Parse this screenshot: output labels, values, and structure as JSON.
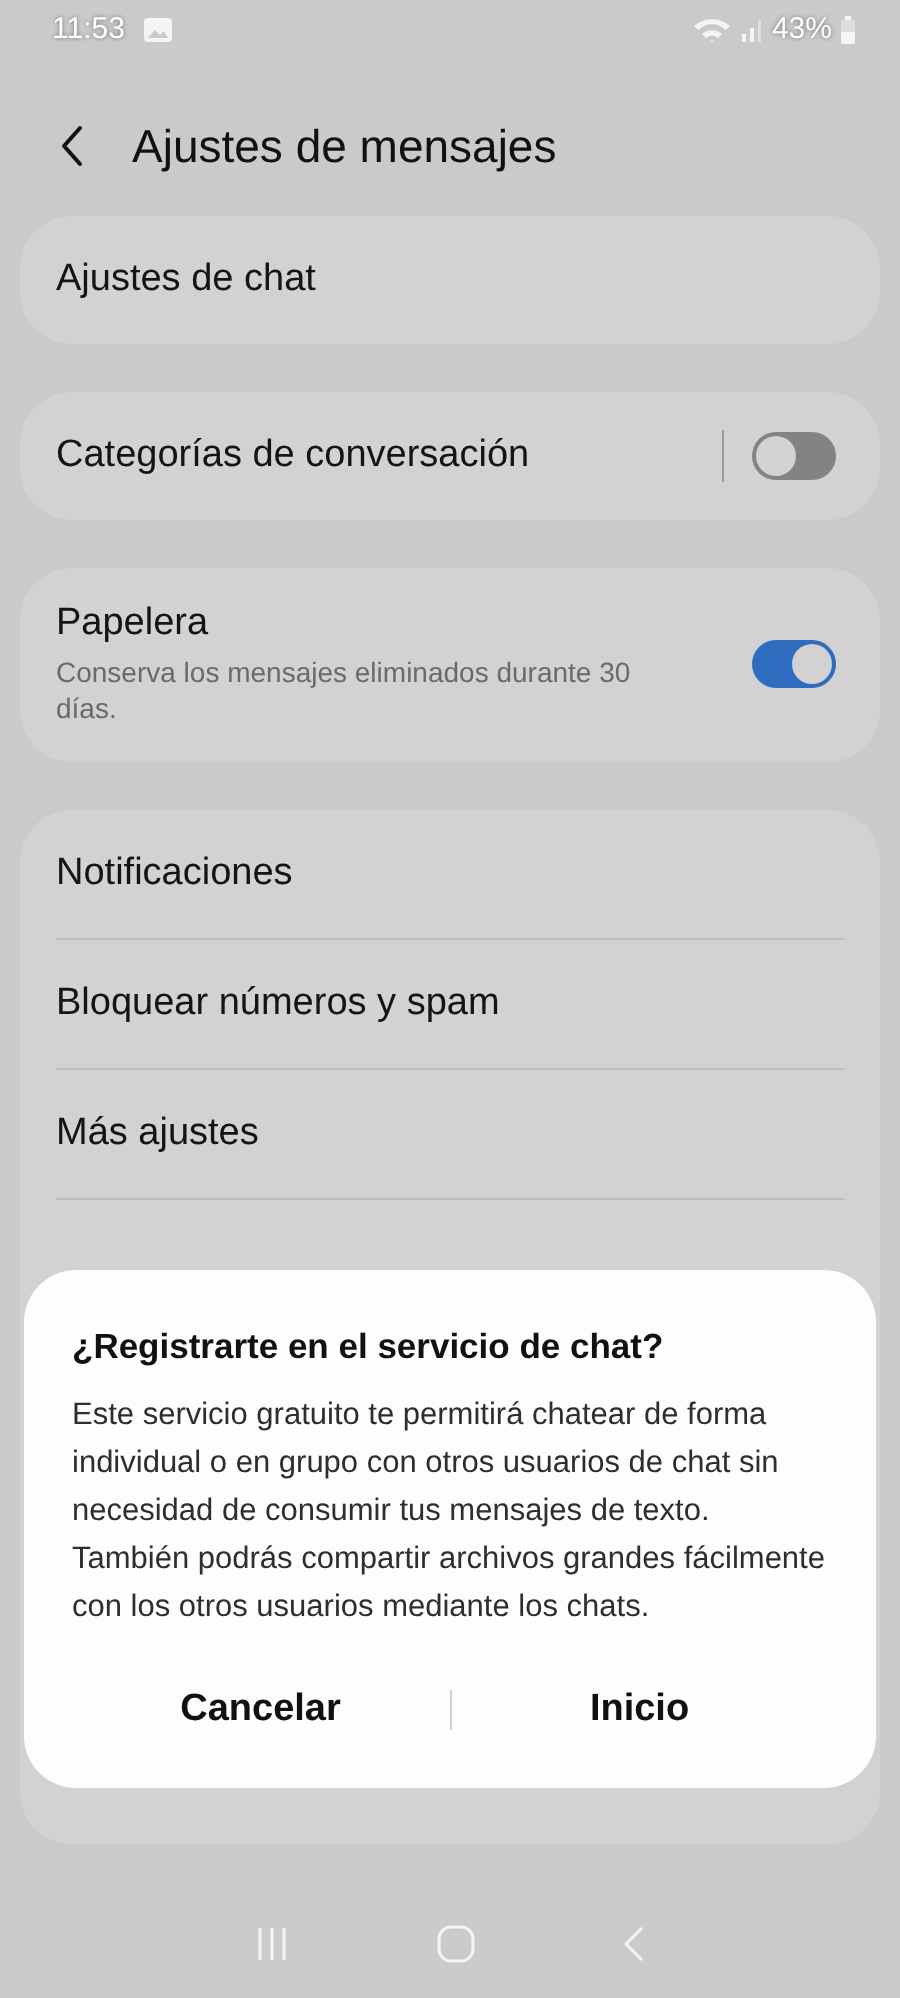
{
  "status_bar": {
    "time": "11:53",
    "battery": "43%"
  },
  "header": {
    "title": "Ajustes de mensajes"
  },
  "sections": [
    {
      "rows": [
        {
          "kind": "link",
          "title": "Ajustes de chat"
        }
      ]
    },
    {
      "rows": [
        {
          "kind": "toggle",
          "title": "Categorías de conversación",
          "on": false
        }
      ]
    },
    {
      "rows": [
        {
          "kind": "toggle",
          "title": "Papelera",
          "subtitle": "Conserva los mensajes eliminados durante 30 días.",
          "on": true
        }
      ]
    },
    {
      "rows": [
        {
          "kind": "link",
          "title": "Notificaciones"
        },
        {
          "kind": "link",
          "title": "Bloquear números y spam"
        },
        {
          "kind": "link",
          "title": "Más ajustes"
        }
      ]
    }
  ],
  "dialog": {
    "title": "¿Registrarte en el servicio de chat?",
    "body": "Este servicio gratuito te permitirá chatear de forma individual o en grupo con otros usuarios de chat sin necesidad de consumir tus mensajes de texto. También podrás compartir archivos grandes fácilmente con los otros usuarios mediante los chats.",
    "buttons": [
      "Cancelar",
      "Inicio"
    ]
  }
}
